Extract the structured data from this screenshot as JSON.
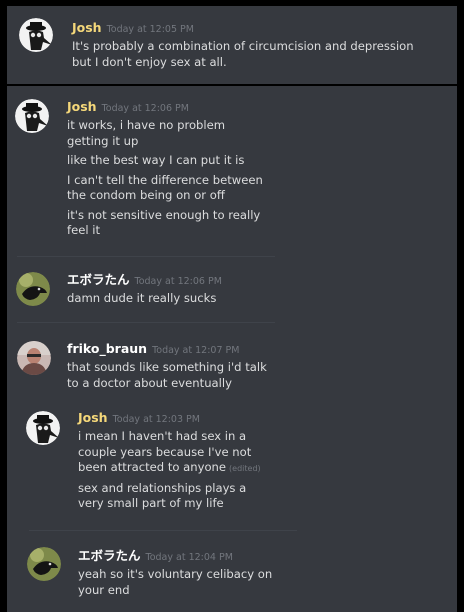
{
  "colors": {
    "background": "#36393f",
    "text": "#dcddde",
    "timestamp": "#72767d",
    "josh_name": "#f5d87a",
    "white_name": "#ffffff"
  },
  "messages": [
    {
      "username": "Josh",
      "timestamp": "Today at 12:05 PM",
      "avatar_icon": "plague-doctor-avatar-icon",
      "lines": [
        "It's probably a combination of circumcision and depression but I don't enjoy sex at all."
      ]
    },
    {
      "username": "Josh",
      "timestamp": "Today at 12:06 PM",
      "avatar_icon": "plague-doctor-avatar-icon",
      "lines": [
        "it works, i have no problem getting it up",
        "like the best way I can put it is",
        "I can't tell the difference between the condom being on or off",
        "it's not sensitive enough to really feel it"
      ]
    },
    {
      "username": "エボラたん",
      "timestamp": "Today at 12:06 PM",
      "avatar_icon": "bird-avatar-icon",
      "lines": [
        "damn dude it really sucks"
      ]
    },
    {
      "username": "friko_braun",
      "timestamp": "Today at 12:07 PM",
      "avatar_icon": "user-photo-avatar-icon",
      "lines": [
        "that sounds like something i'd talk to a doctor about eventually"
      ]
    },
    {
      "username": "Josh",
      "timestamp": "Today at 12:03 PM",
      "avatar_icon": "plague-doctor-avatar-icon",
      "lines": [
        "i mean I haven't had sex in a couple years because I've not been attracted to anyone",
        "sex and relationships plays a very small part of my life"
      ],
      "edited_label": "(edited)"
    },
    {
      "username": "エボラたん",
      "timestamp": "Today at 12:04 PM",
      "avatar_icon": "bird-avatar-icon",
      "lines": [
        "yeah so it's voluntary celibacy on your end"
      ]
    }
  ]
}
